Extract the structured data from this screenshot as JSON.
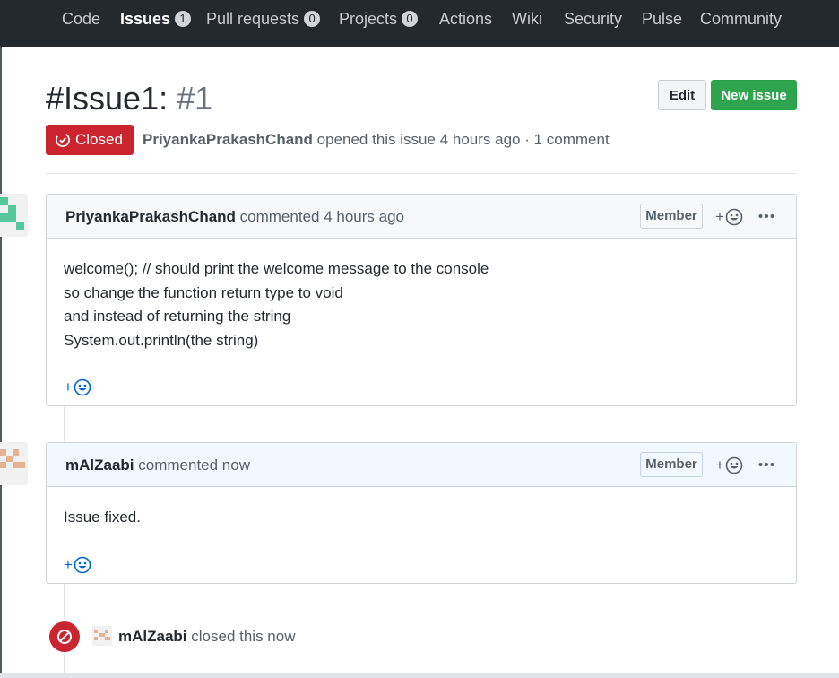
{
  "nav": {
    "tabs": [
      {
        "label": "Code",
        "count": null,
        "active": false
      },
      {
        "label": "Issues",
        "count": "1",
        "active": true
      },
      {
        "label": "Pull requests",
        "count": "0",
        "active": false
      },
      {
        "label": "Projects",
        "count": "0",
        "active": false
      },
      {
        "label": "Actions",
        "count": null,
        "active": false
      },
      {
        "label": "Wiki",
        "count": null,
        "active": false
      },
      {
        "label": "Security",
        "count": null,
        "active": false
      },
      {
        "label": "Pulse",
        "count": null,
        "active": false
      },
      {
        "label": "Community",
        "count": null,
        "active": false
      }
    ]
  },
  "issue": {
    "title": "#Issue1:",
    "number": "#1",
    "state": "Closed",
    "author": "PriyankaPrakashChand",
    "meta_suffix": "opened this issue 4 hours ago · 1 comment"
  },
  "buttons": {
    "edit": "Edit",
    "new_issue": "New issue"
  },
  "comments": [
    {
      "author": "PriyankaPrakashChand",
      "action": "commented 4 hours ago",
      "badge": "Member",
      "reaction_plus": "+",
      "body": [
        "welcome(); // should print the welcome message to the console",
        "so change the function return type to void",
        "and instead of returning the string",
        "System.out.println(the string)"
      ]
    },
    {
      "author": "mAlZaabi",
      "action": "commented now",
      "badge": "Member",
      "reaction_plus": "+",
      "body": [
        "Issue fixed."
      ]
    }
  ],
  "event": {
    "author": "mAlZaabi",
    "action": "closed this now"
  },
  "colors": {
    "nav_bg": "#24292e",
    "closed_red": "#cb2431",
    "new_issue_green": "#2ea44f",
    "link_blue": "#0366d6"
  },
  "icons": {
    "state": "issue-closed-icon",
    "reaction": "smiley-icon",
    "more": "kebab-horizontal-icon",
    "event": "circle-slash-icon"
  }
}
